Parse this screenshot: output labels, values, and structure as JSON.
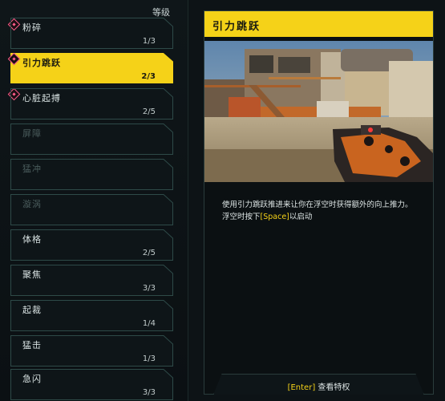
{
  "left": {
    "level_header": "等级",
    "skills": [
      {
        "name": "粉碎",
        "rank": "1/3",
        "state": "normal",
        "marker": true
      },
      {
        "name": "引力跳跃",
        "rank": "2/3",
        "state": "selected",
        "marker": true
      },
      {
        "name": "心脏起搏",
        "rank": "2/5",
        "state": "normal",
        "marker": true
      },
      {
        "name": "屏障",
        "rank": "",
        "state": "locked",
        "marker": false
      },
      {
        "name": "猛冲",
        "rank": "",
        "state": "locked",
        "marker": false
      },
      {
        "name": "漩涡",
        "rank": "",
        "state": "locked",
        "marker": false
      },
      {
        "name": "体格",
        "rank": "2/5",
        "state": "normal",
        "marker": false
      },
      {
        "name": "聚焦",
        "rank": "3/3",
        "state": "normal",
        "marker": false
      },
      {
        "name": "起裁",
        "rank": "1/4",
        "state": "normal",
        "marker": false
      },
      {
        "name": "猛击",
        "rank": "1/3",
        "state": "normal",
        "marker": false
      },
      {
        "name": "急闪",
        "rank": "3/3",
        "state": "normal",
        "marker": false
      }
    ]
  },
  "detail": {
    "title": "引力跳跃",
    "description_line1": "使用引力跳跃推进来让你在浮空时获得额外的向上推力。",
    "description_line2_pre": "浮空时按下",
    "description_key": "[Space]",
    "description_line2_post": "以启动",
    "footer_key": "[Enter]",
    "footer_label": " 查看特权"
  },
  "colors": {
    "accent": "#f5d218",
    "marker": "#ff5d8a",
    "border": "#2e4a48",
    "background": "#0d1316"
  }
}
